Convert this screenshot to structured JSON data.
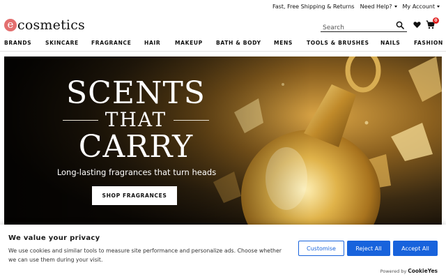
{
  "topbar": {
    "shipping": "Fast, Free Shipping & Returns",
    "help": "Need Help?",
    "account": "My Account"
  },
  "header": {
    "logo_initial": "e",
    "logo_text": "cosmetics",
    "search_placeholder": "Search",
    "cart_count": "0"
  },
  "nav": {
    "items": [
      "BRANDS",
      "SKINCARE",
      "FRAGRANCE",
      "HAIR",
      "MAKEUP",
      "BATH & BODY",
      "MENS",
      "TOOLS & BRUSHES",
      "NAILS",
      "FASHION"
    ]
  },
  "hero": {
    "line1": "SCENTS",
    "line2": "THAT",
    "line3": "CARRY",
    "subtitle": "Long-lasting fragrances that turn heads",
    "cta": "SHOP FRAGRANCES"
  },
  "cookie": {
    "title": "We value your privacy",
    "text": "We use cookies and similar tools to measure site performance and personalize ads. Choose whether we can use them during your visit.",
    "customise": "Customise",
    "reject": "Reject All",
    "accept": "Accept All",
    "powered_prefix": "Powered by",
    "powered_brand": "CookieYes"
  },
  "colors": {
    "accent": "#1863dc",
    "logo": "#e36f6f",
    "badge": "#e02020",
    "hero_gold": "#c9962e"
  },
  "icons": [
    "search-icon",
    "heart-icon",
    "cart-icon",
    "caret-down-icon"
  ]
}
